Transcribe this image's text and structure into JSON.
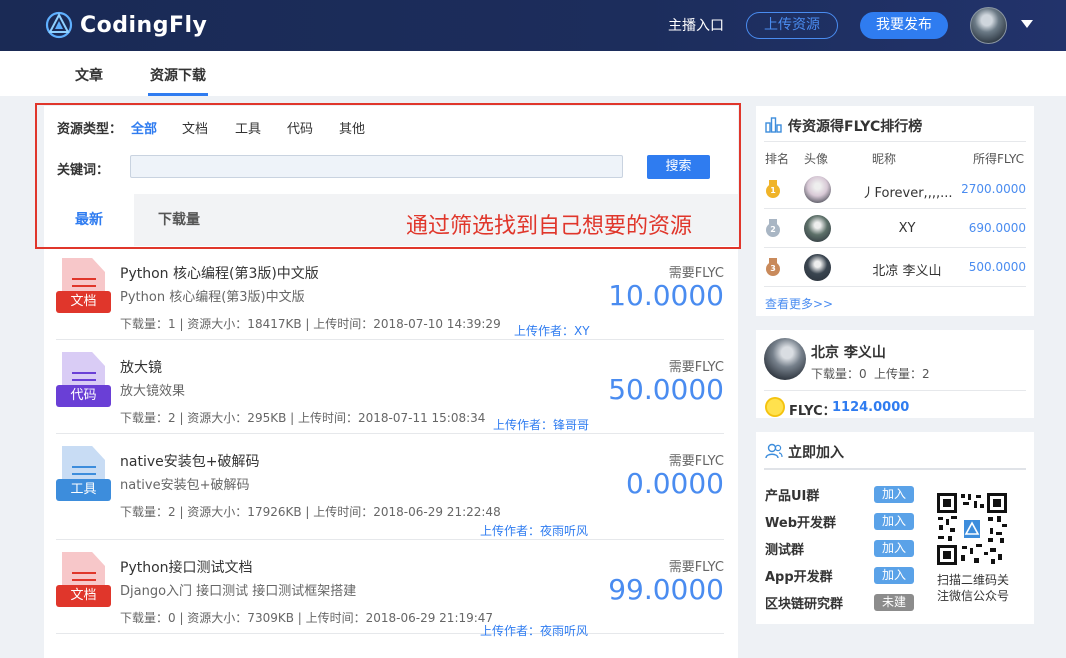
{
  "header": {
    "logo_text": "CodingFly",
    "anchor_label": "主播入口",
    "upload_label": "上传资源",
    "publish_label": "我要发布"
  },
  "subnav": {
    "tabs": [
      "文章",
      "资源下载"
    ],
    "active": "资源下载"
  },
  "filter": {
    "type_label": "资源类型：",
    "types": [
      "全部",
      "文档",
      "工具",
      "代码",
      "其他"
    ],
    "active_type": "全部",
    "keyword_label": "关键词：",
    "keyword_value": "",
    "search_label": "搜索"
  },
  "sort_tabs": [
    "最新",
    "下载量"
  ],
  "annotation": "通过筛选找到自己想要的资源",
  "items": [
    {
      "badge": "文档",
      "badge_color": "#e0362b",
      "paper_color": "#f7c7c9",
      "title": "Python 核心编程(第3版)中文版",
      "desc": "Python 核心编程(第3版)中文版",
      "meta": "下载量：1 | 资源大小：18417KB | 上传时间：2018-07-10 14:39:29",
      "author": "上传作者：XY",
      "need": "需要FLYC",
      "price": "10.0000"
    },
    {
      "badge": "代码",
      "badge_color": "#6a3fd6",
      "paper_color": "#d9ccf5",
      "title": "放大镜",
      "desc": "放大镜效果",
      "meta": "下载量：2 | 资源大小：295KB | 上传时间：2018-07-11 15:08:34",
      "author": "上传作者：锋哥哥",
      "need": "需要FLYC",
      "price": "50.0000"
    },
    {
      "badge": "工具",
      "badge_color": "#3d8ddc",
      "paper_color": "#c8dcf4",
      "title": "native安装包+破解码",
      "desc": "native安装包+破解码",
      "meta": "下载量：2 | 资源大小：17926KB | 上传时间：2018-06-29 21:22:48",
      "author": "上传作者：夜雨听风",
      "need": "需要FLYC",
      "price": "0.0000"
    },
    {
      "badge": "文档",
      "badge_color": "#e0362b",
      "paper_color": "#f7c7c9",
      "title": "Python接口测试文档",
      "desc": "Django入门 接口测试 接口测试框架搭建",
      "meta": "下载量：0 | 资源大小：7309KB | 上传时间：2018-06-29 21:19:47",
      "author": "上传作者：夜雨听风",
      "need": "需要FLYC",
      "price": "99.0000"
    }
  ],
  "ranking": {
    "title": "传资源得FLYC排行榜",
    "headers": [
      "排名",
      "头像",
      "昵称",
      "所得FLYC"
    ],
    "rows": [
      {
        "rank": "1",
        "name": "丿Forever,,,,...",
        "flyc": "2700.0000",
        "medal": "#f0b429",
        "avatar": "#d8c9d6"
      },
      {
        "rank": "2",
        "name": "XY",
        "flyc": "690.0000",
        "medal": "#a9b6c4",
        "avatar": "#5d7069"
      },
      {
        "rank": "3",
        "name": "北凉 李义山",
        "flyc": "500.0000",
        "medal": "#c98a5b",
        "avatar": "#3a4550"
      }
    ],
    "more": "查看更多>>"
  },
  "user": {
    "name": "北京 李义山",
    "downloads": "下载量：0",
    "uploads": "上传量：2",
    "flyc_label": "FLYC：",
    "flyc_value": "1124.0000"
  },
  "join": {
    "title": "立即加入",
    "groups": [
      {
        "name": "产品UI群",
        "btn": "加入",
        "color": "#5aa2e8"
      },
      {
        "name": "Web开发群",
        "btn": "加入",
        "color": "#5aa2e8"
      },
      {
        "name": "测试群",
        "btn": "加入",
        "color": "#5aa2e8"
      },
      {
        "name": "App开发群",
        "btn": "加入",
        "color": "#5aa2e8"
      },
      {
        "name": "区块链研究群",
        "btn": "未建",
        "color": "#8c8c8c"
      }
    ],
    "qr_caption": "扫描二维码关注微信公众号"
  }
}
